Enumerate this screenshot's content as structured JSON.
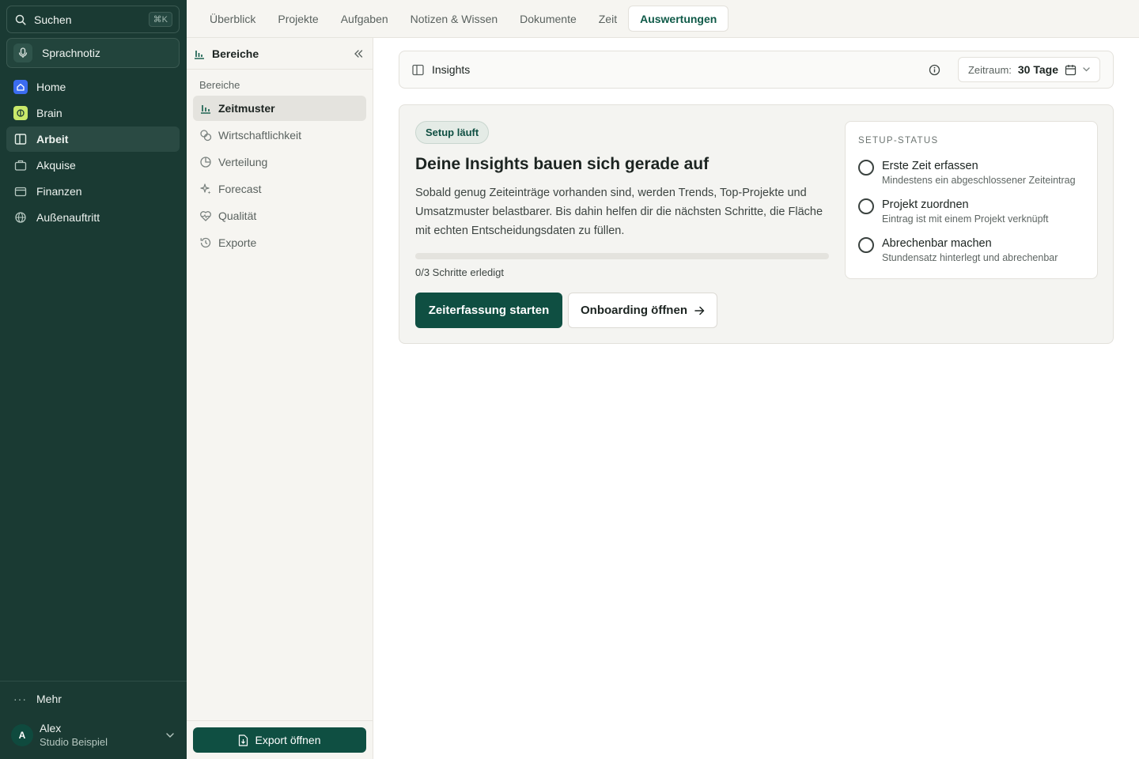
{
  "sidebar": {
    "search_label": "Suchen",
    "search_shortcut": "⌘K",
    "voice_note_label": "Sprachnotiz",
    "items": [
      {
        "label": "Home",
        "icon": "home-icon"
      },
      {
        "label": "Brain",
        "icon": "brain-icon"
      },
      {
        "label": "Arbeit",
        "icon": "columns-icon",
        "active": true
      },
      {
        "label": "Akquise",
        "icon": "briefcase-icon"
      },
      {
        "label": "Finanzen",
        "icon": "wallet-icon"
      },
      {
        "label": "Außenauftritt",
        "icon": "globe-icon"
      }
    ],
    "more_label": "Mehr",
    "user": {
      "initial": "A",
      "name": "Alex",
      "org": "Studio Beispiel"
    }
  },
  "tabs": [
    {
      "label": "Überblick"
    },
    {
      "label": "Projekte"
    },
    {
      "label": "Aufgaben"
    },
    {
      "label": "Notizen & Wissen"
    },
    {
      "label": "Dokumente"
    },
    {
      "label": "Zeit"
    },
    {
      "label": "Auswertungen",
      "active": true
    }
  ],
  "panel": {
    "title": "Bereiche",
    "section_label": "Bereiche",
    "items": [
      {
        "label": "Zeitmuster",
        "icon": "bar-chart-icon",
        "active": true
      },
      {
        "label": "Wirtschaftlichkeit",
        "icon": "coins-icon"
      },
      {
        "label": "Verteilung",
        "icon": "pie-chart-icon"
      },
      {
        "label": "Forecast",
        "icon": "sparkles-icon"
      },
      {
        "label": "Qualität",
        "icon": "heart-pulse-icon"
      },
      {
        "label": "Exporte",
        "icon": "history-icon"
      }
    ],
    "export_label": "Export öffnen"
  },
  "main": {
    "insights_title": "Insights",
    "range_label": "Zeitraum:",
    "range_value": "30 Tage",
    "card": {
      "badge": "Setup läuft",
      "title": "Deine Insights bauen sich gerade auf",
      "description": "Sobald genug Zeiteinträge vorhanden sind, werden Trends, Top-Projekte und Umsatzmuster belastbarer. Bis dahin helfen dir die nächsten Schritte, die Fläche mit echten Entscheidungsdaten zu füllen.",
      "progress_fraction": 0,
      "progress_text": "0/3 Schritte erledigt",
      "primary_button": "Zeiterfassung starten",
      "secondary_button": "Onboarding öffnen"
    },
    "setup_status": {
      "label": "SETUP-STATUS",
      "steps": [
        {
          "title": "Erste Zeit erfassen",
          "subtitle": "Mindestens ein abgeschlossener Zeiteintrag",
          "done": false
        },
        {
          "title": "Projekt zuordnen",
          "subtitle": "Eintrag ist mit einem Projekt verknüpft",
          "done": false
        },
        {
          "title": "Abrechenbar machen",
          "subtitle": "Stundensatz hinterlegt und abrechenbar",
          "done": false
        }
      ]
    }
  },
  "colors": {
    "sidebar_bg": "#1a3a33",
    "accent": "#0f4f42",
    "home_icon_bg": "#3b6cf0",
    "brain_icon_bg": "#c9e86a"
  }
}
